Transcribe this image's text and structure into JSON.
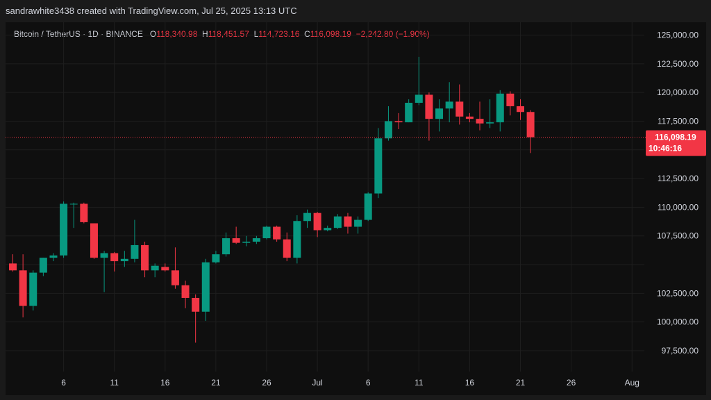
{
  "watermark": "sandrawhite3438 created with TradingView.com, Jul 25, 2025 13:13 UTC",
  "legend": {
    "symbol": "Bitcoin / TetherUS · 1D · BINANCE",
    "open_label": "O",
    "open": "118,340.98",
    "high_label": "H",
    "high": "118,451.57",
    "low_label": "L",
    "low": "114,723.16",
    "close_label": "C",
    "close": "116,098.19",
    "change": "−2,242.80 (−1.90%)"
  },
  "colors": {
    "up": "#089981",
    "down": "#f23645",
    "background": "#0f0f0f",
    "grid": "#1e1e1e"
  },
  "price_tag": {
    "price": "116,098.19",
    "countdown": "10:46:16"
  },
  "chart_data": {
    "type": "candlestick",
    "ylim": [
      95500,
      126000
    ],
    "yticks": [
      97500,
      100000,
      102500,
      105000,
      107500,
      110000,
      112500,
      115000,
      117500,
      120000,
      122500,
      125000
    ],
    "ytick_labels": [
      "97,500.00",
      "100,000.00",
      "102,500.00",
      "",
      "107,500.00",
      "110,000.00",
      "112,500.00",
      "",
      "117,500.00",
      "120,000.00",
      "122,500.00",
      "125,000.00"
    ],
    "xticks": [
      {
        "label": "6",
        "index": 5
      },
      {
        "label": "11",
        "index": 10
      },
      {
        "label": "16",
        "index": 15
      },
      {
        "label": "21",
        "index": 20
      },
      {
        "label": "26",
        "index": 25
      },
      {
        "label": "Jul",
        "index": 30
      },
      {
        "label": "6",
        "index": 35
      },
      {
        "label": "11",
        "index": 40
      },
      {
        "label": "16",
        "index": 45
      },
      {
        "label": "21",
        "index": 50
      },
      {
        "label": "26",
        "index": 55
      },
      {
        "label": "Aug",
        "index": 61
      }
    ],
    "last_close": 116098.19,
    "candles": [
      {
        "o": 105100,
        "h": 105900,
        "l": 104400,
        "c": 104500
      },
      {
        "o": 104500,
        "h": 105900,
        "l": 100400,
        "c": 101400
      },
      {
        "o": 101400,
        "h": 104500,
        "l": 101000,
        "c": 104300
      },
      {
        "o": 104300,
        "h": 105600,
        "l": 104000,
        "c": 105600
      },
      {
        "o": 105600,
        "h": 106000,
        "l": 105300,
        "c": 105800
      },
      {
        "o": 105800,
        "h": 110500,
        "l": 105600,
        "c": 110300
      },
      {
        "o": 110300,
        "h": 110400,
        "l": 108200,
        "c": 110300
      },
      {
        "o": 110300,
        "h": 110400,
        "l": 108600,
        "c": 108700
      },
      {
        "o": 108600,
        "h": 108600,
        "l": 105500,
        "c": 105600
      },
      {
        "o": 105600,
        "h": 106200,
        "l": 102600,
        "c": 106000
      },
      {
        "o": 106000,
        "h": 106100,
        "l": 104400,
        "c": 105300
      },
      {
        "o": 105300,
        "h": 106200,
        "l": 104800,
        "c": 105500
      },
      {
        "o": 105500,
        "h": 108900,
        "l": 105200,
        "c": 106700
      },
      {
        "o": 106700,
        "h": 107000,
        "l": 103900,
        "c": 104500
      },
      {
        "o": 104500,
        "h": 105100,
        "l": 103900,
        "c": 104900
      },
      {
        "o": 104800,
        "h": 105100,
        "l": 104400,
        "c": 104500
      },
      {
        "o": 104500,
        "h": 106500,
        "l": 102900,
        "c": 103200
      },
      {
        "o": 103200,
        "h": 103600,
        "l": 101200,
        "c": 102100
      },
      {
        "o": 102100,
        "h": 102400,
        "l": 98200,
        "c": 100900
      },
      {
        "o": 100900,
        "h": 105500,
        "l": 100100,
        "c": 105200
      },
      {
        "o": 105200,
        "h": 106200,
        "l": 105100,
        "c": 105900
      },
      {
        "o": 105900,
        "h": 107800,
        "l": 105700,
        "c": 107300
      },
      {
        "o": 107300,
        "h": 108300,
        "l": 106800,
        "c": 106900
      },
      {
        "o": 106900,
        "h": 107500,
        "l": 106600,
        "c": 107000
      },
      {
        "o": 107000,
        "h": 107500,
        "l": 106800,
        "c": 107300
      },
      {
        "o": 107300,
        "h": 108400,
        "l": 107200,
        "c": 108300
      },
      {
        "o": 108300,
        "h": 108400,
        "l": 107000,
        "c": 107200
      },
      {
        "o": 107200,
        "h": 107800,
        "l": 105300,
        "c": 105600
      },
      {
        "o": 105600,
        "h": 109300,
        "l": 105100,
        "c": 108800
      },
      {
        "o": 108800,
        "h": 109800,
        "l": 108200,
        "c": 109500
      },
      {
        "o": 109500,
        "h": 109600,
        "l": 107400,
        "c": 108000
      },
      {
        "o": 108000,
        "h": 108400,
        "l": 107900,
        "c": 108200
      },
      {
        "o": 108200,
        "h": 109400,
        "l": 108100,
        "c": 109200
      },
      {
        "o": 109200,
        "h": 109500,
        "l": 107700,
        "c": 108300
      },
      {
        "o": 108300,
        "h": 109200,
        "l": 107700,
        "c": 108900
      },
      {
        "o": 108900,
        "h": 111300,
        "l": 108800,
        "c": 111200
      },
      {
        "o": 111200,
        "h": 116900,
        "l": 110800,
        "c": 116000
      },
      {
        "o": 116000,
        "h": 118800,
        "l": 115800,
        "c": 117500
      },
      {
        "o": 117500,
        "h": 118200,
        "l": 116800,
        "c": 117400
      },
      {
        "o": 117400,
        "h": 119400,
        "l": 117400,
        "c": 119100
      },
      {
        "o": 119100,
        "h": 123100,
        "l": 118900,
        "c": 119800
      },
      {
        "o": 119800,
        "h": 120000,
        "l": 115800,
        "c": 117700
      },
      {
        "o": 117700,
        "h": 119400,
        "l": 116600,
        "c": 118600
      },
      {
        "o": 118600,
        "h": 120900,
        "l": 117400,
        "c": 119200
      },
      {
        "o": 119200,
        "h": 120700,
        "l": 117200,
        "c": 117900
      },
      {
        "o": 117900,
        "h": 118200,
        "l": 117400,
        "c": 117700
      },
      {
        "o": 117700,
        "h": 119200,
        "l": 116700,
        "c": 117300
      },
      {
        "o": 117300,
        "h": 119400,
        "l": 116900,
        "c": 117400
      },
      {
        "o": 117400,
        "h": 120200,
        "l": 116600,
        "c": 119900
      },
      {
        "o": 119900,
        "h": 120100,
        "l": 118000,
        "c": 118800
      },
      {
        "o": 118800,
        "h": 119400,
        "l": 117600,
        "c": 118300
      },
      {
        "o": 118300,
        "h": 118451.57,
        "l": 114723.16,
        "c": 116098.19
      }
    ]
  }
}
